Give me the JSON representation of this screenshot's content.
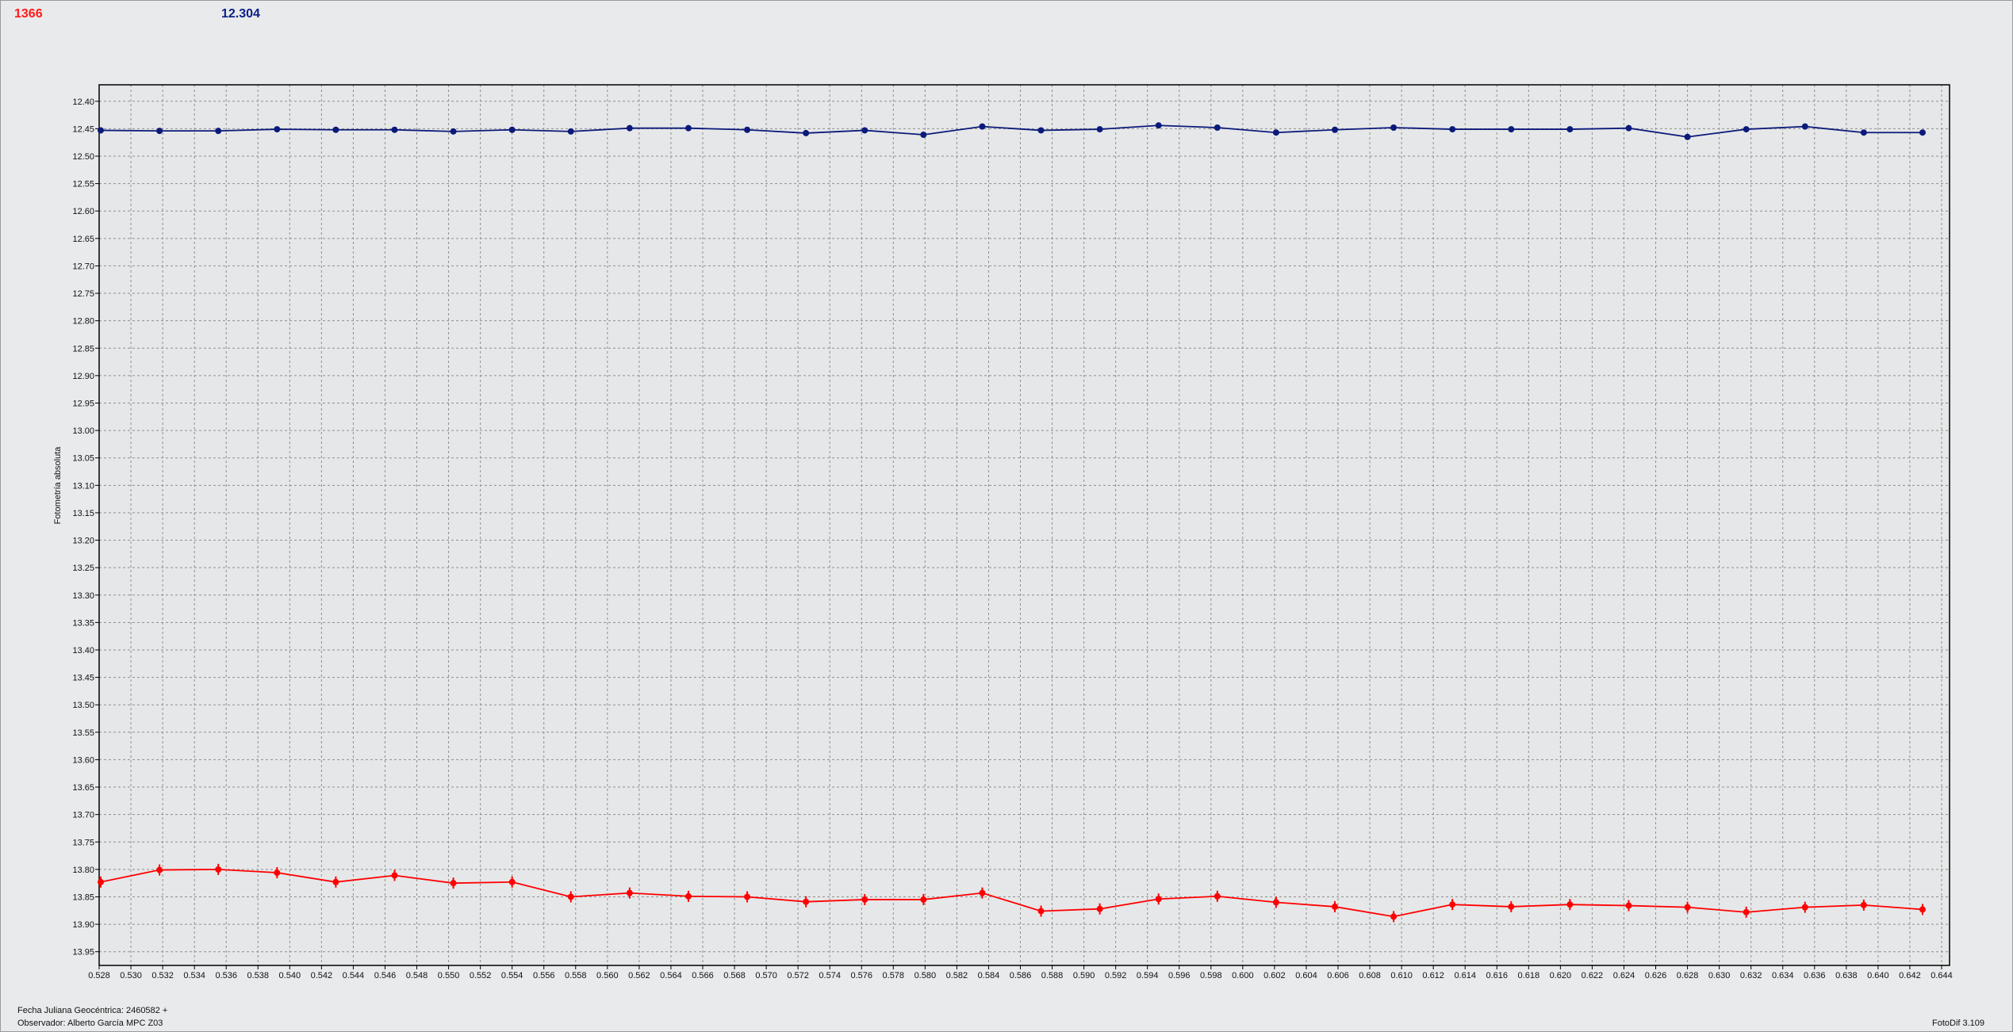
{
  "header": {
    "red_value": "1366",
    "blue_value": "12.304"
  },
  "footer": {
    "line1": "Fecha Juliana Geocéntrica: 2460582 +",
    "line2": "Observador: Alberto García MPC Z03",
    "version": "FotoDif 3.109"
  },
  "colors": {
    "red_series": "#ff0000",
    "blue_series": "#0b1a7a",
    "plot_background": "#e6e7e8",
    "grid": "#8f8f8f"
  },
  "chart_data": {
    "type": "line",
    "title": "",
    "xlabel": "",
    "ylabel": "Fotometría absoluta",
    "xlim": [
      0.528,
      0.6445
    ],
    "ylim": [
      12.37,
      13.975
    ],
    "y_inverted": true,
    "grid": true,
    "x_ticks": [
      "0.528",
      "0.530",
      "0.532",
      "0.534",
      "0.536",
      "0.538",
      "0.540",
      "0.542",
      "0.544",
      "0.546",
      "0.548",
      "0.550",
      "0.552",
      "0.554",
      "0.556",
      "0.558",
      "0.560",
      "0.562",
      "0.564",
      "0.566",
      "0.568",
      "0.570",
      "0.572",
      "0.574",
      "0.576",
      "0.578",
      "0.580",
      "0.582",
      "0.584",
      "0.586",
      "0.588",
      "0.590",
      "0.592",
      "0.594",
      "0.596",
      "0.598",
      "0.600",
      "0.602",
      "0.604",
      "0.606",
      "0.608",
      "0.610",
      "0.612",
      "0.614",
      "0.616",
      "0.618",
      "0.620",
      "0.622",
      "0.624",
      "0.626",
      "0.628",
      "0.630",
      "0.632",
      "0.634",
      "0.636",
      "0.638",
      "0.640",
      "0.642",
      "0.644"
    ],
    "y_ticks": [
      "12.40",
      "12.45",
      "12.50",
      "12.55",
      "12.60",
      "12.65",
      "12.70",
      "12.75",
      "12.80",
      "12.85",
      "12.90",
      "12.95",
      "13.00",
      "13.05",
      "13.10",
      "13.15",
      "13.20",
      "13.25",
      "13.30",
      "13.35",
      "13.40",
      "13.45",
      "13.50",
      "13.55",
      "13.60",
      "13.65",
      "13.70",
      "13.75",
      "13.80",
      "13.85",
      "13.90",
      "13.95"
    ],
    "x": [
      0.5281,
      0.5318,
      0.5355,
      0.5392,
      0.5429,
      0.5466,
      0.5503,
      0.554,
      0.5577,
      0.5614,
      0.5651,
      0.5688,
      0.5725,
      0.5762,
      0.5799,
      0.5836,
      0.5873,
      0.591,
      0.5947,
      0.5984,
      0.6021,
      0.6058,
      0.6095,
      0.6132,
      0.6169,
      0.6206,
      0.6243,
      0.628,
      0.6317,
      0.6354,
      0.6391,
      0.6428
    ],
    "series": [
      {
        "values": [
          12.453,
          12.454,
          12.454,
          12.451,
          12.452,
          12.452,
          12.455,
          12.452,
          12.455,
          12.449,
          12.449,
          12.452,
          12.458,
          12.453,
          12.461,
          12.446,
          12.453,
          12.451,
          12.444,
          12.448,
          12.457,
          12.452,
          12.448,
          12.451,
          12.451,
          12.451,
          12.449,
          12.465,
          12.451,
          12.446,
          12.457,
          12.457
        ],
        "color": "#0b1a7a",
        "marker": "circle",
        "error_bars": false
      },
      {
        "values": [
          13.823,
          13.801,
          13.8,
          13.806,
          13.823,
          13.811,
          13.825,
          13.823,
          13.85,
          13.843,
          13.849,
          13.85,
          13.859,
          13.855,
          13.855,
          13.843,
          13.876,
          13.872,
          13.854,
          13.849,
          13.86,
          13.868,
          13.886,
          13.864,
          13.868,
          13.864,
          13.866,
          13.869,
          13.878,
          13.869,
          13.865,
          13.873
        ],
        "color": "#ff0000",
        "marker": "circle",
        "error_bars": true
      }
    ]
  }
}
